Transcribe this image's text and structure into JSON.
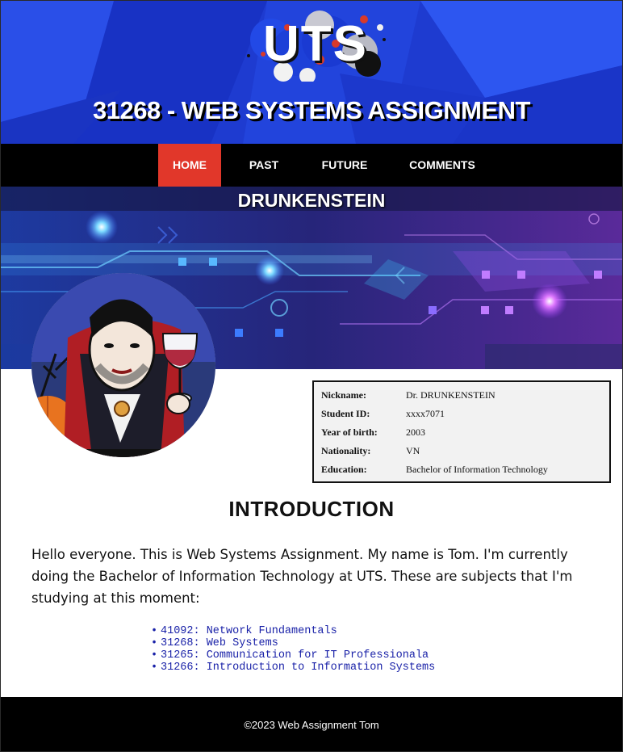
{
  "header": {
    "logo_text": "UTS",
    "site_title": "31268 - WEB SYSTEMS ASSIGNMENT",
    "bg_color": "#1f3fd6"
  },
  "nav": {
    "items": [
      {
        "label": "HOME",
        "active": true
      },
      {
        "label": "PAST",
        "active": false
      },
      {
        "label": "FUTURE",
        "active": false
      },
      {
        "label": "COMMENTS",
        "active": false
      }
    ],
    "active_color": "#e1372a"
  },
  "banner": {
    "title": "DRUNKENSTEIN"
  },
  "profile": {
    "rows": [
      {
        "label": "Nickname:",
        "value": "Dr. DRUNKENSTEIN"
      },
      {
        "label": "Student ID:",
        "value": "xxxx7071"
      },
      {
        "label": "Year of birth:",
        "value": "2003"
      },
      {
        "label": "Nationality:",
        "value": "VN"
      },
      {
        "label": "Education:",
        "value": "Bachelor of Information Technology"
      }
    ]
  },
  "intro": {
    "title": "INTRODUCTION",
    "text": "Hello everyone. This is Web Systems Assignment. My name is Tom. I'm currently doing the Bachelor of Information Technology at UTS. These are subjects that I'm studying at this moment:",
    "subjects": [
      "41092: Network Fundamentals",
      "31268: Web Systems",
      "31265: Communication for IT Professionala",
      "31266: Introduction to Information Systems"
    ],
    "link_color": "#1a22a8"
  },
  "footer": {
    "text": "©2023 Web Assignment Tom"
  }
}
